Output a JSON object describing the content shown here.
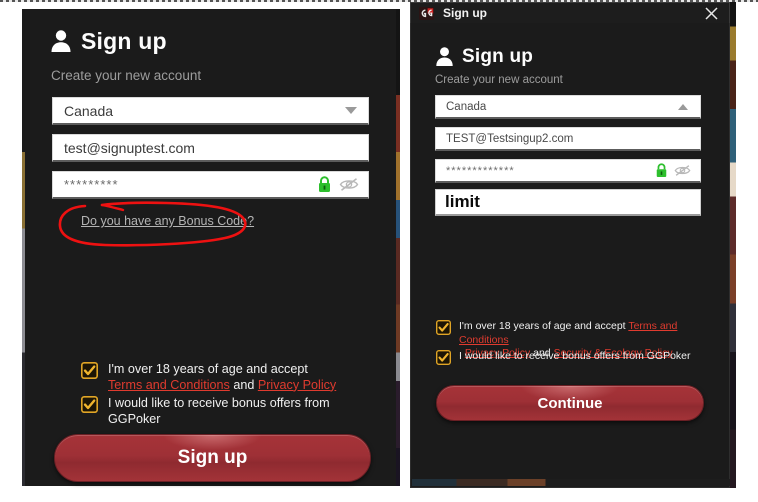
{
  "left": {
    "header": {
      "icon": "person-icon",
      "title": "Sign up",
      "subtitle": "Create your new account"
    },
    "country": {
      "value": "Canada",
      "chevron": "chevron-down-icon"
    },
    "email": {
      "value": "test@signuptest.com"
    },
    "password": {
      "value": "*********",
      "lock_icon": "lock-icon",
      "eye_icon": "eye-slash-icon"
    },
    "bonus_link": "Do you have any Bonus Code?",
    "annotation": {
      "shape": "hand-drawn-ellipse",
      "color": "#ee1111"
    },
    "checkbox_age": {
      "checked": true,
      "text_line1": "I'm over 18 years of age and accept",
      "link1": "Terms and Conditions",
      "and": "and",
      "link2": "Privacy Policy"
    },
    "checkbox_bonus": {
      "checked": true,
      "text": "I would like to receive bonus offers from GGPoker"
    },
    "submit": {
      "label": "Sign up"
    }
  },
  "right": {
    "titlebar": {
      "icon": "ggpoker-logo-icon",
      "title": "Sign up",
      "close": "close-icon"
    },
    "header": {
      "icon": "person-icon",
      "title": "Sign up",
      "subtitle": "Create your new account"
    },
    "country": {
      "value": "Canada",
      "chevron": "chevron-up-icon"
    },
    "email": {
      "value": "TEST@Testsingup2.com"
    },
    "password": {
      "value": "*************",
      "lock_icon": "lock-icon",
      "eye_icon": "eye-slash-icon"
    },
    "bonus_code": {
      "value": "limit"
    },
    "checkbox_age": {
      "checked": true,
      "text_line1": "I'm over 18 years of age and accept",
      "link1": "Terms and Conditions",
      "comma": ",",
      "link2": "Privacy Policy",
      "and": "and",
      "link3": "Security & Ecology Policy"
    },
    "checkbox_bonus": {
      "checked": true,
      "text": "I would like to receive bonus offers from GGPoker"
    },
    "submit": {
      "label": "Continue"
    }
  },
  "colors": {
    "panel_bg": "#1b1b1b",
    "button_red": "#a33338",
    "link_red": "#e03b2f",
    "checkbox_gold": "#e8a92a",
    "annotation_red": "#ee1111",
    "lock_green": "#2dbf2d"
  }
}
